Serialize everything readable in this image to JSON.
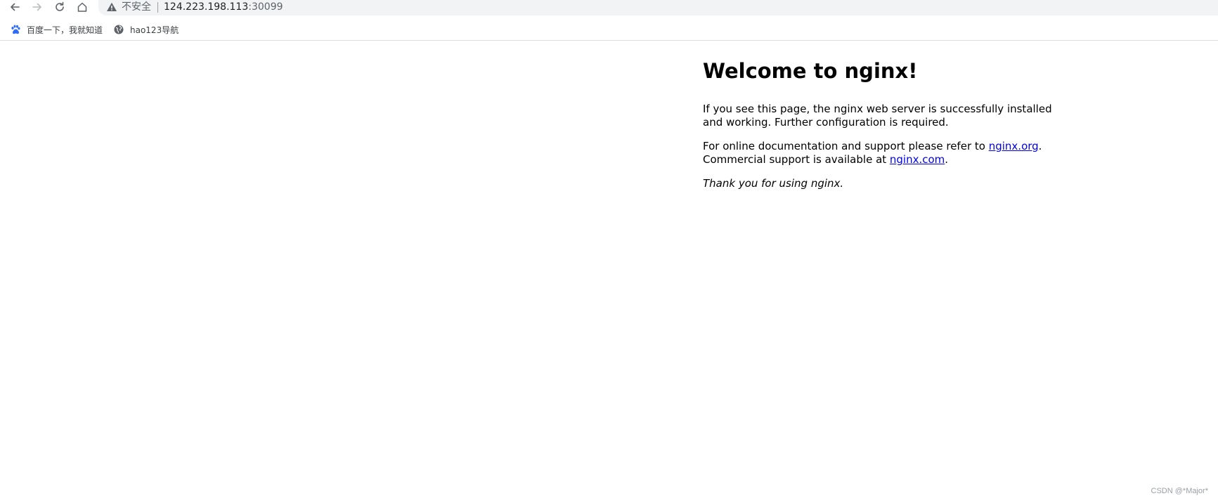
{
  "toolbar": {
    "back_icon": "arrow-left-icon",
    "forward_icon": "arrow-right-icon",
    "reload_icon": "reload-icon",
    "home_icon": "home-icon",
    "security_icon": "warning-triangle-icon",
    "security_label": "不安全",
    "url_host": "124.223.198.113",
    "url_port": ":30099"
  },
  "bookmarks": [
    {
      "icon": "baidu-paw-icon",
      "label": "百度一下，我就知道"
    },
    {
      "icon": "globe-icon",
      "label": "hao123导航"
    }
  ],
  "page": {
    "title": "Welcome to nginx!",
    "para1": "If you see this page, the nginx web server is successfully installed and working. Further configuration is required.",
    "para2_prefix": "For online documentation and support please refer to ",
    "link_org": "nginx.org",
    "para2_mid": ".",
    "para2_line2_prefix": "Commercial support is available at ",
    "link_com": "nginx.com",
    "para2_suffix": ".",
    "thanks": "Thank you for using nginx."
  },
  "watermark": "CSDN @*Major*",
  "colors": {
    "link": "#0000ee",
    "omnibox_bg": "#f1f3f4",
    "baidu_blue": "#2f6cf6"
  }
}
